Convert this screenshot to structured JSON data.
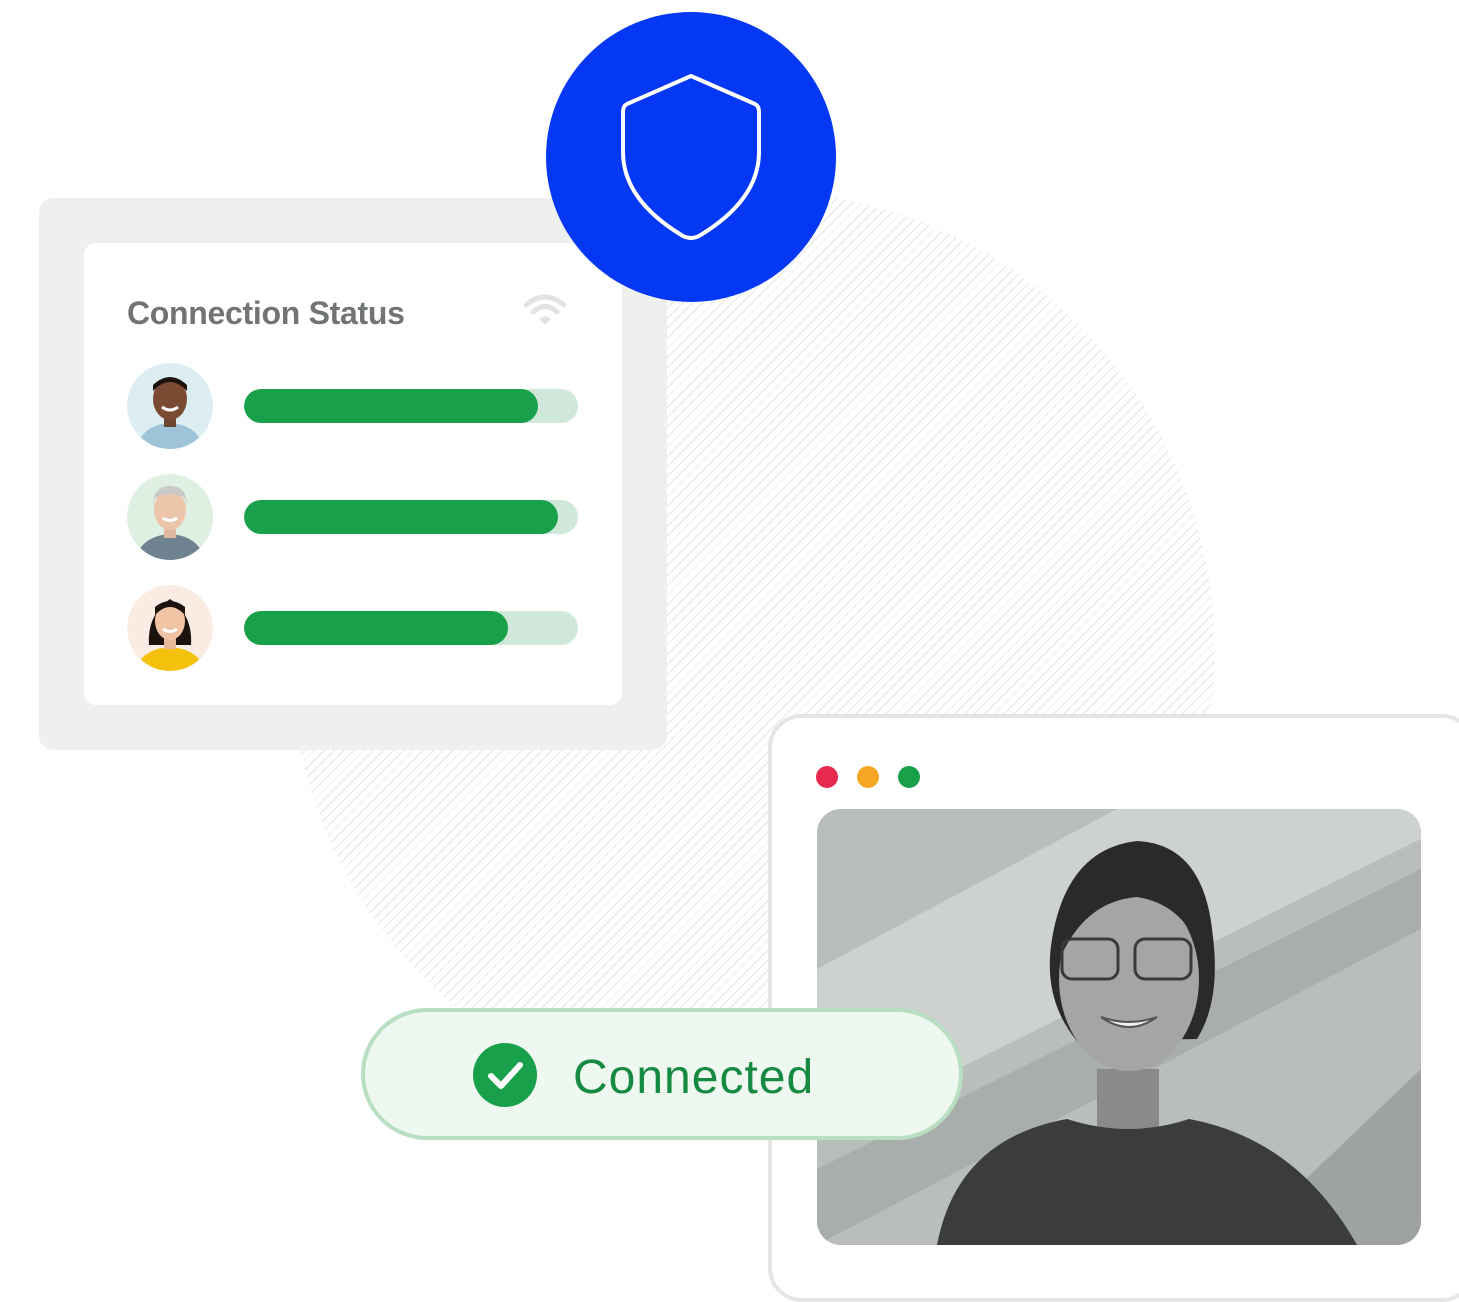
{
  "connection_status": {
    "title": "Connection Status",
    "icon": "wifi-icon",
    "users": [
      {
        "avatar": "man-avatar",
        "avatar_bg": "#ddeef3",
        "shirt": "#9fc3d8",
        "signal_percent": 88
      },
      {
        "avatar": "gray-hair-woman-avatar",
        "avatar_bg": "#dff0e2",
        "shirt": "#6f8290",
        "signal_percent": 94
      },
      {
        "avatar": "woman-avatar",
        "avatar_bg": "#fbece3",
        "shirt": "#f4c20d",
        "signal_percent": 79
      }
    ]
  },
  "shield": {
    "icon": "shield-icon",
    "color": "#0538f5"
  },
  "video_window": {
    "controls": [
      {
        "name": "close-dot",
        "color": "#e8294f"
      },
      {
        "name": "minimize-dot",
        "color": "#f5a623"
      },
      {
        "name": "maximize-dot",
        "color": "#18a04b"
      }
    ],
    "participant": "video-participant"
  },
  "status_badge": {
    "icon": "check-circle-icon",
    "label": "Connected",
    "color": "#18a04b"
  }
}
